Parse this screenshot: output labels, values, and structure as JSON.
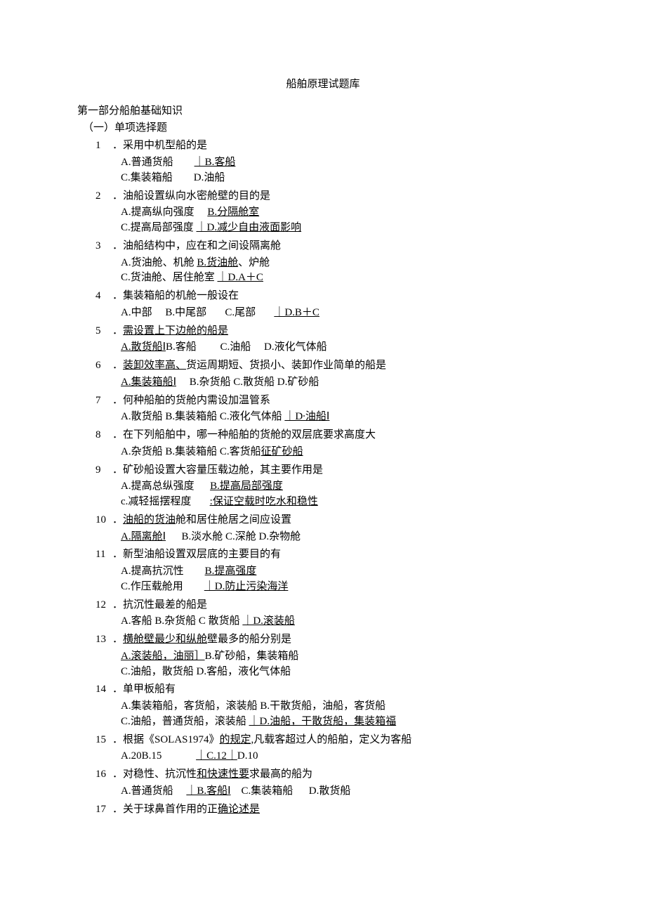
{
  "doc_title": "船舶原理试题库",
  "section_head": "第一部分船舶基础知识",
  "subsection_head": "（一）单项选择题",
  "questions": [
    {
      "num": "1",
      "stem_pre": "．采用中机型船的是",
      "opt_rows": [
        {
          "segs": [
            {
              "t": "A.普通货船        "
            },
            {
              "t": "｜B.客船",
              "u": true
            }
          ]
        },
        {
          "segs": [
            {
              "t": "C.集装箱船        D.油船"
            }
          ]
        }
      ]
    },
    {
      "num": "2",
      "stem_pre": "．油船设置纵向水密舱壁的目的是",
      "opt_rows": [
        {
          "segs": [
            {
              "t": "A.提高纵向强度     "
            },
            {
              "t": "B.分隔舱室",
              "u": true
            }
          ]
        },
        {
          "segs": [
            {
              "t": "C.提高局部强度 "
            },
            {
              "t": "｜D.减少自由液面影响",
              "u": true
            }
          ]
        }
      ]
    },
    {
      "num": "3",
      "stem_pre": "．油船结构中，应在和之间设隔离舱",
      "opt_rows": [
        {
          "segs": [
            {
              "t": "A.货油舱、机舱 "
            },
            {
              "t": "B.货油舱",
              "u": true
            },
            {
              "t": "、炉舱"
            }
          ]
        },
        {
          "segs": [
            {
              "t": "C.货油舱、居住舱室 "
            },
            {
              "t": "｜D.A＋C",
              "u": true
            }
          ]
        }
      ]
    },
    {
      "num": "4",
      "stem_pre": "．集装箱船的机舱一般设在",
      "opt_rows": [
        {
          "segs": [
            {
              "t": "A.中部     B.中尾部       C.尾部       "
            },
            {
              "t": "｜D.B＋C",
              "u": true
            }
          ]
        }
      ]
    },
    {
      "num": "5",
      "stem_segs": [
        {
          "t": "．"
        },
        {
          "t": "需设置上下边舱的船是",
          "u": true
        }
      ],
      "opt_rows": [
        {
          "segs": [
            {
              "t": "A.散货船Ⅰ",
              "u": true
            },
            {
              "t": "B.客船         C.油船     D.液化气体船"
            }
          ]
        }
      ]
    },
    {
      "num": "6",
      "stem_segs": [
        {
          "t": "．"
        },
        {
          "t": "装卸效率高、",
          "u": true
        },
        {
          "t": "货运周期短、货损小、装卸作业简单的船是"
        }
      ],
      "opt_rows": [
        {
          "segs": [
            {
              "t": "A.集装箱船Ⅰ",
              "u": true
            },
            {
              "t": "     B.杂货船 C.散货船 D.矿砂船"
            }
          ]
        }
      ]
    },
    {
      "num": "7",
      "stem_pre": "．何种船舶的货舱内需设加温管系",
      "opt_rows": [
        {
          "segs": [
            {
              "t": "A.散货船 B.集装箱船 C.液化气体船 "
            },
            {
              "t": "｜D∙油船Ⅰ",
              "u": true
            }
          ]
        }
      ]
    },
    {
      "num": "8",
      "stem_pre": "．在下列船舶中，哪一种船舶的货舱的双层底要求高度大",
      "opt_rows": [
        {
          "segs": [
            {
              "t": "A.杂货船 B.集装箱船 C.客货船"
            },
            {
              "t": "征矿砂船",
              "u": true
            }
          ]
        }
      ]
    },
    {
      "num": "9",
      "stem_pre": "．矿砂船设置大容量压载边舱，其主要作用是",
      "opt_rows": [
        {
          "segs": [
            {
              "t": "A.提高总纵强度      "
            },
            {
              "t": "B.提高局部强度",
              "u": true
            }
          ]
        },
        {
          "segs": [
            {
              "t": "c.减轻摇摆程度       "
            },
            {
              "t": ":保证空载时吃水和稳性",
              "u": true
            }
          ]
        }
      ]
    },
    {
      "num": "10",
      "stem_segs": [
        {
          "t": "．"
        },
        {
          "t": "油船的货油",
          "u": true
        },
        {
          "t": "舱和居住舱居之间应设置"
        }
      ],
      "opt_rows": [
        {
          "segs": [
            {
              "t": "A.隔离舱Ⅰ",
              "u": true
            },
            {
              "t": "      B.淡水舱 C.深舱 D.杂物舱"
            }
          ]
        }
      ]
    },
    {
      "num": "11",
      "stem_pre": "．新型油船设置双层底的主要目的有",
      "opt_rows": [
        {
          "segs": [
            {
              "t": "A.提高抗沉性        "
            },
            {
              "t": "B.提高强度",
              "u": true
            }
          ]
        },
        {
          "segs": [
            {
              "t": "C.作压载舱用        "
            },
            {
              "t": "｜D.防止污染海洋",
              "u": true
            }
          ]
        }
      ]
    },
    {
      "num": "12",
      "stem_pre": "．抗沉性最差的船是",
      "opt_rows": [
        {
          "segs": [
            {
              "t": "A.客船 B.杂货船 C 散货船 "
            },
            {
              "t": "｜D.滚装船",
              "u": true
            }
          ]
        }
      ]
    },
    {
      "num": "13",
      "stem_segs": [
        {
          "t": "．"
        },
        {
          "t": "横舱壁最少和纵舱",
          "u": true
        },
        {
          "t": "壁最多的船分别是"
        }
      ],
      "opt_rows": [
        {
          "segs": [
            {
              "t": "A.滚装船，油丽］",
              "u": true
            },
            {
              "t": "B.矿砂船，集装箱船"
            }
          ]
        },
        {
          "segs": [
            {
              "t": "C.油船，散货船 D.客船，液化气体船"
            }
          ]
        }
      ]
    },
    {
      "num": "14",
      "stem_pre": "．单甲板船有",
      "opt_rows": [
        {
          "segs": [
            {
              "t": "A.集装箱船，客货船，滚装船 B.干散货船，油船，客货船"
            }
          ]
        },
        {
          "segs": [
            {
              "t": "C.油船，普通货船，滚装船 "
            },
            {
              "t": "｜D.油船，干散货船，集装箱福",
              "u": true
            }
          ]
        }
      ]
    },
    {
      "num": "15",
      "stem_segs": [
        {
          "t": "．根据《SOLAS1974》"
        },
        {
          "t": "的规定,",
          "u": true
        },
        {
          "t": "凡载客超过人的船舶，定义为客船"
        }
      ],
      "opt_rows": [
        {
          "segs": [
            {
              "t": "A.20B.15             "
            },
            {
              "t": "｜C.12｜",
              "u": true
            },
            {
              "t": "D.10"
            }
          ]
        }
      ]
    },
    {
      "num": "16",
      "stem_segs": [
        {
          "t": "．对稳性、抗沉性"
        },
        {
          "t": "和快速性要",
          "u": true
        },
        {
          "t": "求最高的船为"
        }
      ],
      "opt_rows": [
        {
          "segs": [
            {
              "t": "A.普通货船     "
            },
            {
              "t": "｜B.客船Ⅰ",
              "u": true
            },
            {
              "t": "    C.集装箱船      D.散货船"
            }
          ]
        }
      ]
    },
    {
      "num": "17",
      "stem_segs": [
        {
          "t": "．关于球鼻首作用的正"
        },
        {
          "t": "确论述是",
          "u": true
        }
      ],
      "opt_rows": []
    }
  ]
}
